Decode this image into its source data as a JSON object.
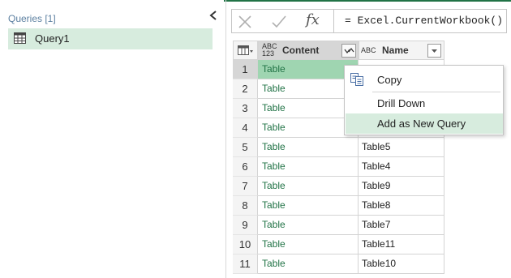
{
  "queries_pane": {
    "header": "Queries [1]",
    "items": [
      {
        "label": "Query1",
        "icon": "table-icon"
      }
    ]
  },
  "formula_bar": {
    "fx_label": "fx",
    "formula": "= Excel.CurrentWorkbook()"
  },
  "grid": {
    "columns": [
      {
        "label": "Content",
        "type_icon": "ABC 123"
      },
      {
        "label": "Name",
        "type_icon": "ABC"
      }
    ],
    "rows": [
      {
        "num": "1",
        "content": "Table",
        "name": ""
      },
      {
        "num": "2",
        "content": "Table",
        "name": ""
      },
      {
        "num": "3",
        "content": "Table",
        "name": ""
      },
      {
        "num": "4",
        "content": "Table",
        "name": ""
      },
      {
        "num": "5",
        "content": "Table",
        "name": "Table5"
      },
      {
        "num": "6",
        "content": "Table",
        "name": "Table4"
      },
      {
        "num": "7",
        "content": "Table",
        "name": "Table9"
      },
      {
        "num": "8",
        "content": "Table",
        "name": "Table8"
      },
      {
        "num": "9",
        "content": "Table",
        "name": "Table7"
      },
      {
        "num": "10",
        "content": "Table",
        "name": "Table11"
      },
      {
        "num": "11",
        "content": "Table",
        "name": "Table10"
      }
    ],
    "selected_row": 1
  },
  "context_menu": {
    "items": [
      {
        "label": "Copy",
        "icon": "copy-icon"
      },
      {
        "label": "Drill Down"
      },
      {
        "label": "Add as New Query",
        "highlighted": true
      }
    ]
  },
  "colors": {
    "accent": "#217346",
    "selection": "#9fd5b1",
    "highlight": "#d7ecde"
  }
}
